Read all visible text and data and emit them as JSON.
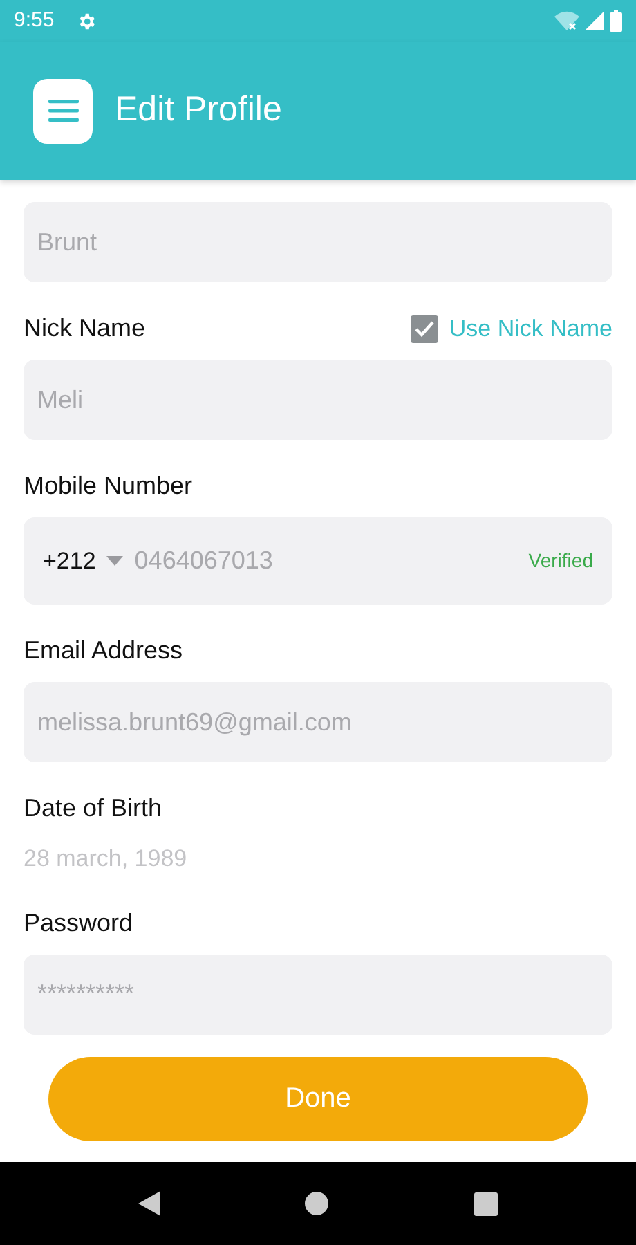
{
  "status_bar": {
    "time": "9:55"
  },
  "header": {
    "title": "Edit Profile"
  },
  "fields": [
    {
      "kind": "text",
      "value": "Brunt"
    },
    {
      "kind": "text",
      "label": "Nick Name",
      "option": {
        "label": "Use Nick Name",
        "checked": true
      },
      "value": "Meli"
    },
    {
      "kind": "phone",
      "label": "Mobile Number",
      "code": "+212",
      "value": "0464067013",
      "status": "Verified"
    },
    {
      "kind": "text",
      "label": "Email Address",
      "value": "melissa.brunt69@gmail.com"
    },
    {
      "kind": "date",
      "label": "Date of Birth",
      "value": "28 march, 1989"
    },
    {
      "kind": "text",
      "label": "Password",
      "value": "**********"
    }
  ],
  "done_button": "Done"
}
